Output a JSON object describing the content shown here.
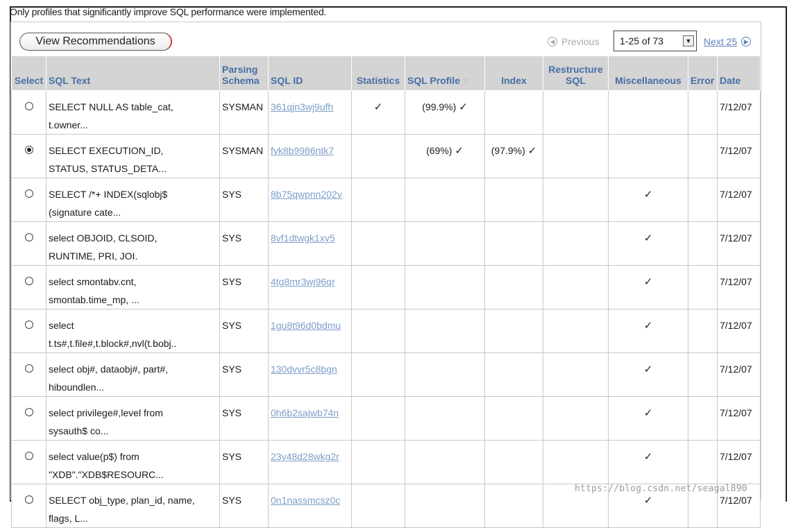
{
  "info_text": "Only profiles that significantly improve SQL performance were implemented.",
  "view_button": "View Recommendations",
  "pagination": {
    "previous": "Previous",
    "range_value": "1-25 of 73",
    "next": "Next 25"
  },
  "columns": {
    "select": "Select",
    "sql_text": "SQL Text",
    "parsing_schema_1": "Parsing",
    "parsing_schema_2": "Schema",
    "sql_id": "SQL ID",
    "statistics": "Statistics",
    "sql_profile": "SQL Profile",
    "index": "Index",
    "restructure_1": "Restructure",
    "restructure_2": "SQL",
    "misc": "Miscellaneous",
    "error": "Error",
    "date": "Date"
  },
  "rows": [
    {
      "selected": false,
      "text1": "SELECT NULL AS table_cat,",
      "text2": "t.owner...",
      "schema": "SYSMAN",
      "sql_id": "361qjn3wj9ufh",
      "statistics": "✓",
      "profile": "(99.9%)",
      "profile_check": "✓",
      "index": "",
      "index_check": "",
      "misc": "",
      "date": "7/12/07"
    },
    {
      "selected": true,
      "text1": "SELECT EXECUTION_ID,",
      "text2": "STATUS, STATUS_DETA...",
      "schema": "SYSMAN",
      "sql_id": "fyk8b9986ntk7",
      "statistics": "",
      "profile": "(69%)",
      "profile_check": "✓",
      "index": "(97.9%)",
      "index_check": "✓",
      "misc": "",
      "date": "7/12/07"
    },
    {
      "selected": false,
      "text1": "SELECT /*+ INDEX(sqlobj$",
      "text2": "(signature cate...",
      "schema": "SYS",
      "sql_id": "8b75qwpnn202v",
      "statistics": "",
      "profile": "",
      "profile_check": "",
      "index": "",
      "index_check": "",
      "misc": "✓",
      "date": "7/12/07"
    },
    {
      "selected": false,
      "text1": "select OBJOID, CLSOID,",
      "text2": "RUNTIME, PRI, JOI.",
      "schema": "SYS",
      "sql_id": "8vf1dtwgk1xy5",
      "statistics": "",
      "profile": "",
      "profile_check": "",
      "index": "",
      "index_check": "",
      "misc": "✓",
      "date": "7/12/07"
    },
    {
      "selected": false,
      "text1": "select smontabv.cnt,",
      "text2": "smontab.time_mp, ...",
      "schema": "SYS",
      "sql_id": "4tg8mr3wj96qr",
      "statistics": "",
      "profile": "",
      "profile_check": "",
      "index": "",
      "index_check": "",
      "misc": "✓",
      "date": "7/12/07"
    },
    {
      "selected": false,
      "text1": "select",
      "text2": "t.ts#,t.file#,t.block#,nvl(t.bobj..",
      "schema": "SYS",
      "sql_id": "1gu8t96d0bdmu",
      "statistics": "",
      "profile": "",
      "profile_check": "",
      "index": "",
      "index_check": "",
      "misc": "✓",
      "date": "7/12/07"
    },
    {
      "selected": false,
      "text1": "select obj#, dataobj#, part#,",
      "text2": "hiboundlen...",
      "schema": "SYS",
      "sql_id": "130dvvr5c8bgn",
      "statistics": "",
      "profile": "",
      "profile_check": "",
      "index": "",
      "index_check": "",
      "misc": "✓",
      "date": "7/12/07"
    },
    {
      "selected": false,
      "text1": "select privilege#,level from",
      "text2": "sysauth$ co...",
      "schema": "SYS",
      "sql_id": "0h6b2sajwb74n",
      "statistics": "",
      "profile": "",
      "profile_check": "",
      "index": "",
      "index_check": "",
      "misc": "✓",
      "date": "7/12/07"
    },
    {
      "selected": false,
      "text1": "select value(p$) from",
      "text2": "\"XDB\".\"XDB$RESOURC...",
      "schema": "SYS",
      "sql_id": "23y48d28wkg2r",
      "statistics": "",
      "profile": "",
      "profile_check": "",
      "index": "",
      "index_check": "",
      "misc": "✓",
      "date": "7/12/07"
    },
    {
      "selected": false,
      "text1": "SELECT obj_type, plan_id, name,",
      "text2": "flags, L...",
      "schema": "SYS",
      "sql_id": "0n1nassmcsz0c",
      "statistics": "",
      "profile": "",
      "profile_check": "",
      "index": "",
      "index_check": "",
      "misc": "✓",
      "date": "7/12/07"
    }
  ],
  "watermark": "https://blog.csdn.net/seagal890"
}
